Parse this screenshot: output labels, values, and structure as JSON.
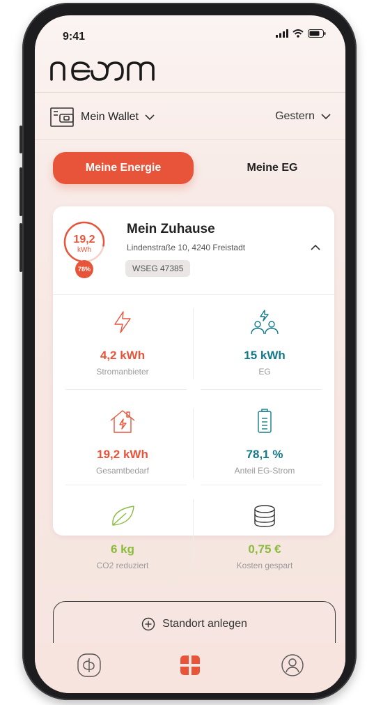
{
  "status_bar": {
    "time": "9:41"
  },
  "app": {
    "logo_text": "neoom"
  },
  "wallet": {
    "label": "Mein Wallet"
  },
  "period": {
    "label": "Gestern"
  },
  "tabs": [
    {
      "label": "Meine Energie",
      "active": true
    },
    {
      "label": "Meine EG",
      "active": false
    }
  ],
  "site": {
    "ring_value": "19,2",
    "ring_unit": "kWh",
    "ring_percent_label": "78%",
    "ring_fill_fraction": 0.78,
    "name": "Mein Zuhause",
    "address": "Lindenstraße 10, 4240 Freistadt",
    "tag": "WSEG 47385"
  },
  "metrics": [
    {
      "value": "4,2 kWh",
      "label": "Stromanbieter",
      "icon": "lightning-icon"
    },
    {
      "value": "15 kWh",
      "label": "EG",
      "icon": "community-lightning-icon"
    },
    {
      "value": "19,2 kWh",
      "label": "Gesamtbedarf",
      "icon": "house-lightning-icon"
    },
    {
      "value": "78,1 %",
      "label": "Anteil EG-Strom",
      "icon": "battery-icon"
    },
    {
      "value": "6 kg",
      "label": "CO2 reduziert",
      "icon": "leaf-icon"
    },
    {
      "value": "0,75 €",
      "label": "Kosten gespart",
      "icon": "coins-icon"
    }
  ],
  "add_site": {
    "label": "Standort anlegen"
  },
  "colors": {
    "accent": "#e8543a",
    "teal": "#147a8a",
    "green": "#8bbb3c"
  }
}
